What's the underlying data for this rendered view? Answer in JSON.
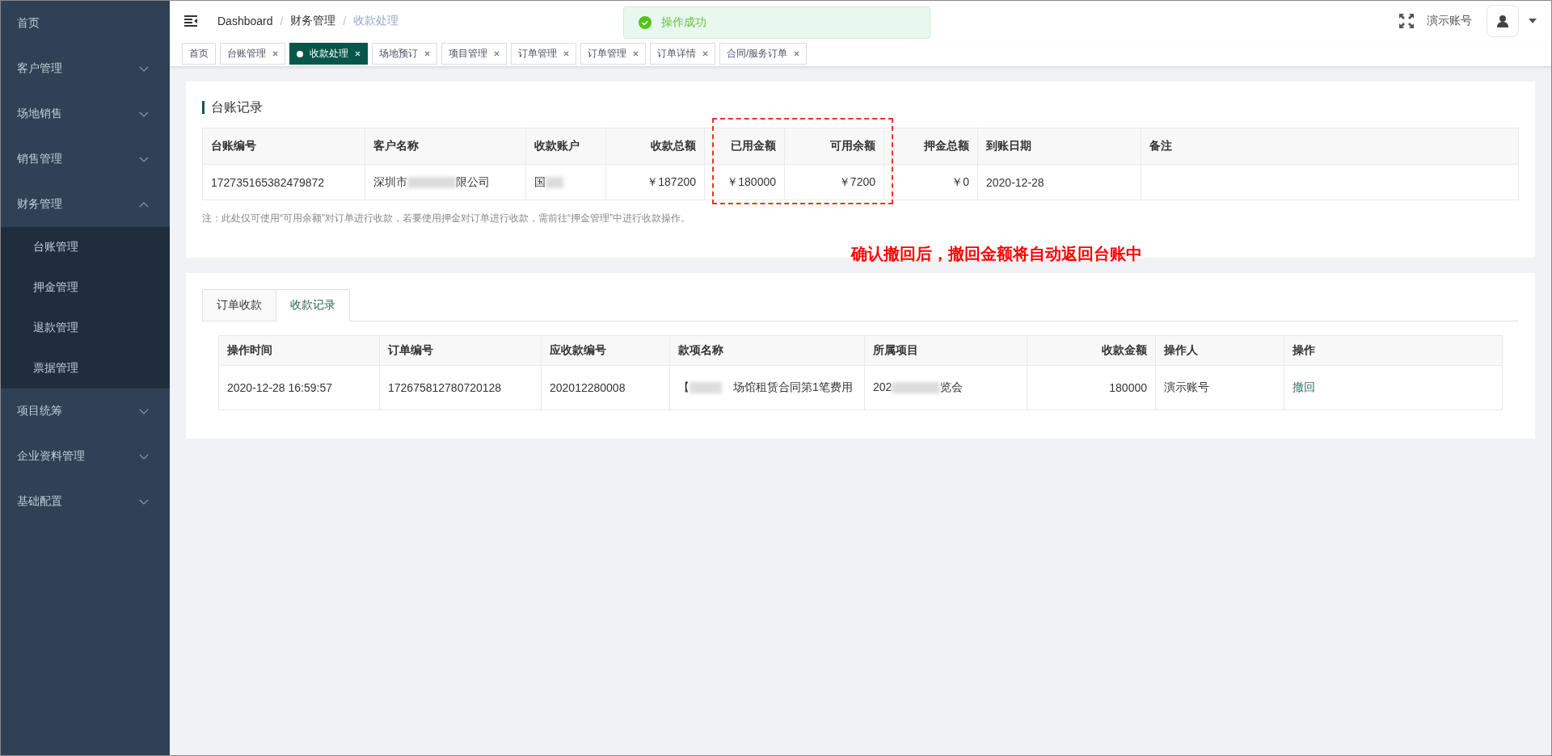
{
  "sidebar": {
    "items": [
      {
        "label": "首页"
      },
      {
        "label": "客户管理",
        "expanded": false
      },
      {
        "label": "场地销售",
        "expanded": false
      },
      {
        "label": "销售管理",
        "expanded": false
      },
      {
        "label": "财务管理",
        "expanded": true,
        "children": [
          {
            "label": "台账管理"
          },
          {
            "label": "押金管理"
          },
          {
            "label": "退款管理"
          },
          {
            "label": "票据管理"
          }
        ]
      },
      {
        "label": "项目统筹",
        "expanded": false
      },
      {
        "label": "企业资料管理",
        "expanded": false
      },
      {
        "label": "基础配置",
        "expanded": false
      }
    ]
  },
  "header": {
    "breadcrumb": [
      "Dashboard",
      "财务管理",
      "收款处理"
    ],
    "separator": "/",
    "user": "演示账号"
  },
  "tags": [
    {
      "label": "首页",
      "closable": false,
      "selected": false
    },
    {
      "label": "台账管理",
      "closable": true,
      "selected": false
    },
    {
      "label": "收款处理",
      "closable": true,
      "selected": true
    },
    {
      "label": "场地预订",
      "closable": true,
      "selected": false
    },
    {
      "label": "项目管理",
      "closable": true,
      "selected": false
    },
    {
      "label": "订单管理",
      "closable": true,
      "selected": false
    },
    {
      "label": "订单管理",
      "closable": true,
      "selected": false
    },
    {
      "label": "订单详情",
      "closable": true,
      "selected": false
    },
    {
      "label": "合同/服务订单",
      "closable": true,
      "selected": false
    }
  ],
  "toast": {
    "message": "操作成功"
  },
  "ledger": {
    "title": "台账记录",
    "columns": [
      {
        "label": "台账编号",
        "kind": "text",
        "highlighted": false
      },
      {
        "label": "客户名称",
        "kind": "text",
        "highlighted": false
      },
      {
        "label": "收款账户",
        "kind": "text",
        "highlighted": false
      },
      {
        "label": "收款总额",
        "kind": "amount",
        "highlighted": false
      },
      {
        "label": "已用金额",
        "kind": "amount",
        "highlighted": true
      },
      {
        "label": "可用余额",
        "kind": "amount",
        "highlighted": true
      },
      {
        "label": "押金总额",
        "kind": "amount",
        "highlighted": false
      },
      {
        "label": "到账日期",
        "kind": "text",
        "highlighted": false
      },
      {
        "label": "备注",
        "kind": "text",
        "highlighted": false
      }
    ],
    "rows": [
      [
        "172735165382479872",
        {
          "before": "深圳市",
          "after": "限公司"
        },
        {
          "before": "国"
        },
        "￥187200",
        "￥180000",
        "￥7200",
        "￥0",
        "2020-12-28",
        ""
      ]
    ],
    "note": "注：此处仅可使用“可用余额”对订单进行收款，若要使用押金对订单进行收款，需前往“押金管理”中进行收款操作。"
  },
  "annotation": "确认撤回后，撤回金额将自动返回台账中",
  "tabs": [
    {
      "label": "订单收款",
      "selected": false
    },
    {
      "label": "收款记录",
      "selected": true
    }
  ],
  "records": {
    "columns": [
      {
        "label": "操作时间",
        "kind": "text"
      },
      {
        "label": "订单编号",
        "kind": "text"
      },
      {
        "label": "应收款编号",
        "kind": "text"
      },
      {
        "label": "款项名称",
        "kind": "text"
      },
      {
        "label": "所属项目",
        "kind": "text"
      },
      {
        "label": "收款金额",
        "kind": "amount"
      },
      {
        "label": "操作人",
        "kind": "text"
      },
      {
        "label": "操作",
        "kind": "text"
      }
    ],
    "rows": [
      [
        "2020-12-28 16:59:57",
        "172675812780720128",
        "202012280008",
        {
          "before": "【",
          "after": "场馆租赁合同第1笔费用"
        },
        {
          "before": "202",
          "after": "览会"
        },
        "180000",
        "演示账号",
        {
          "text": "撤回",
          "kind": "link"
        }
      ]
    ]
  }
}
